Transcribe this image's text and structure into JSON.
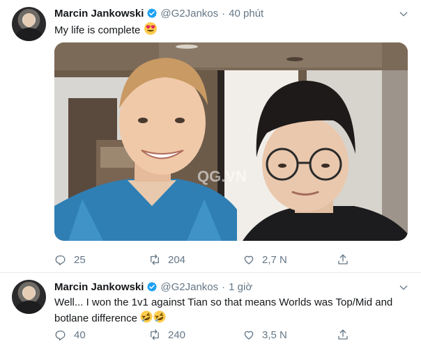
{
  "tweets": [
    {
      "author_name": "Marcin Jankowski",
      "handle": "@G2Jankos",
      "separator": "·",
      "time": "40 phút",
      "text": "My life is complete",
      "emoji_icon": "heart-eyes-emoji",
      "watermark": "QG.VN",
      "stats": {
        "replies": "25",
        "retweets": "204",
        "likes": "2,7 N"
      }
    },
    {
      "author_name": "Marcin Jankowski",
      "handle": "@G2Jankos",
      "separator": "·",
      "time": "1 giờ",
      "text": "Well... I won the 1v1 against Tian so that means Worlds was Top/Mid and botlane difference",
      "emoji_icon": "rolling-laughing-emoji",
      "stats": {
        "replies": "40",
        "retweets": "240",
        "likes": "3,5 N"
      }
    }
  ],
  "colors": {
    "verified": "#1da1f2",
    "muted": "#657786",
    "text": "#14171a",
    "divider": "#e6ecf0"
  }
}
